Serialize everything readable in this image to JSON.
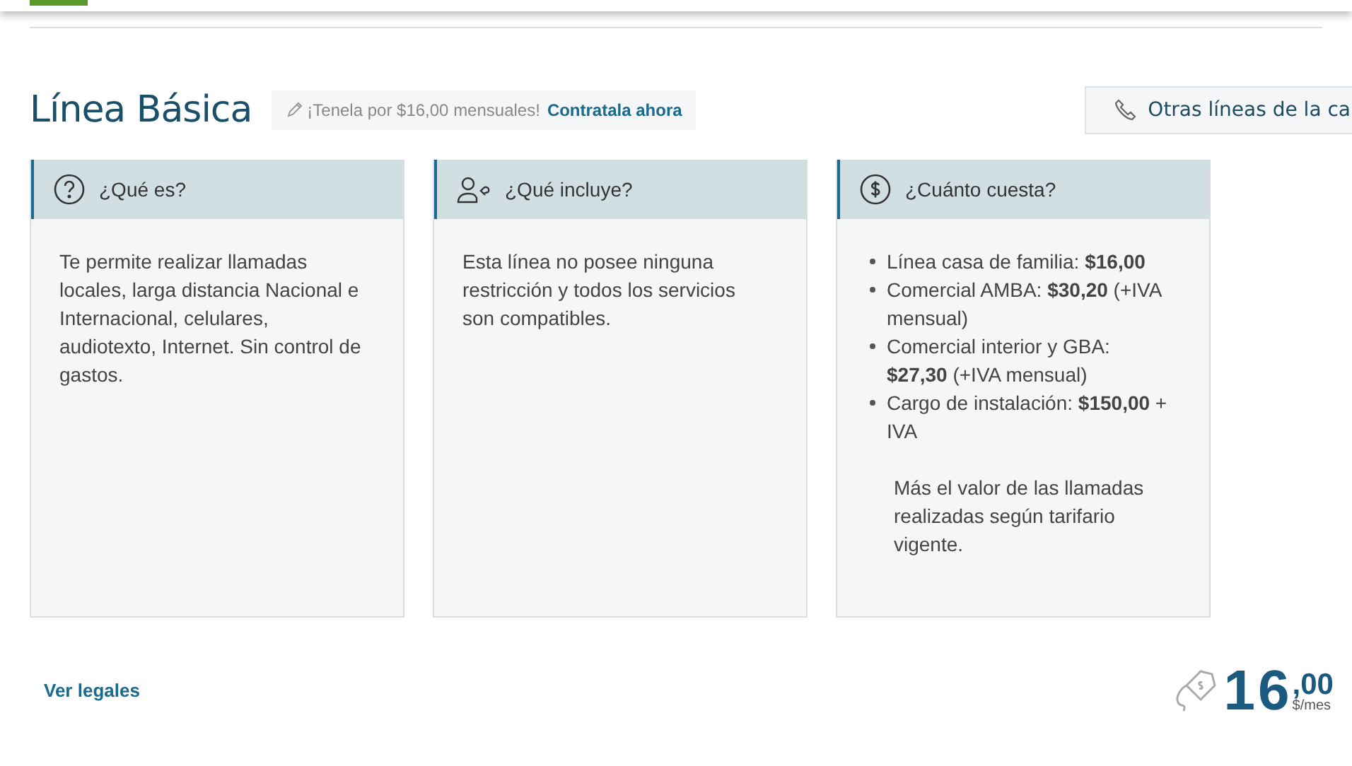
{
  "header": {
    "title": "Línea Básica",
    "promo": {
      "text": "¡Tenela por $16,00 mensuales!",
      "link": "Contratala ahora"
    },
    "other_lines_button": "Otras líneas de la ca"
  },
  "cards": [
    {
      "kind": "question",
      "title": "¿Qué es?",
      "body": "Te permite realizar llamadas locales, larga distancia Nacional e Internacional, celulares, audiotexto, Internet. Sin control de gastos."
    },
    {
      "kind": "service",
      "title": "¿Qué incluye?",
      "body": "Esta línea no posee ninguna restricción y todos los servicios son compatibles."
    },
    {
      "kind": "price",
      "title": "¿Cuánto cuesta?",
      "items": [
        "Línea casa de familia: **$16,00**",
        "Comercial AMBA: **$30,20** (+IVA mensual)",
        "Comercial interior y GBA: **$27,30** (+IVA mensual)",
        "Cargo de instalación: **$150,00** + IVA"
      ],
      "note": "Más el valor de las llamadas realizadas según tarifario vigente."
    }
  ],
  "footer": {
    "legal_link": "Ver legales",
    "price": {
      "integer": "16",
      "decimals": ",00",
      "unit": "$/mes"
    }
  }
}
